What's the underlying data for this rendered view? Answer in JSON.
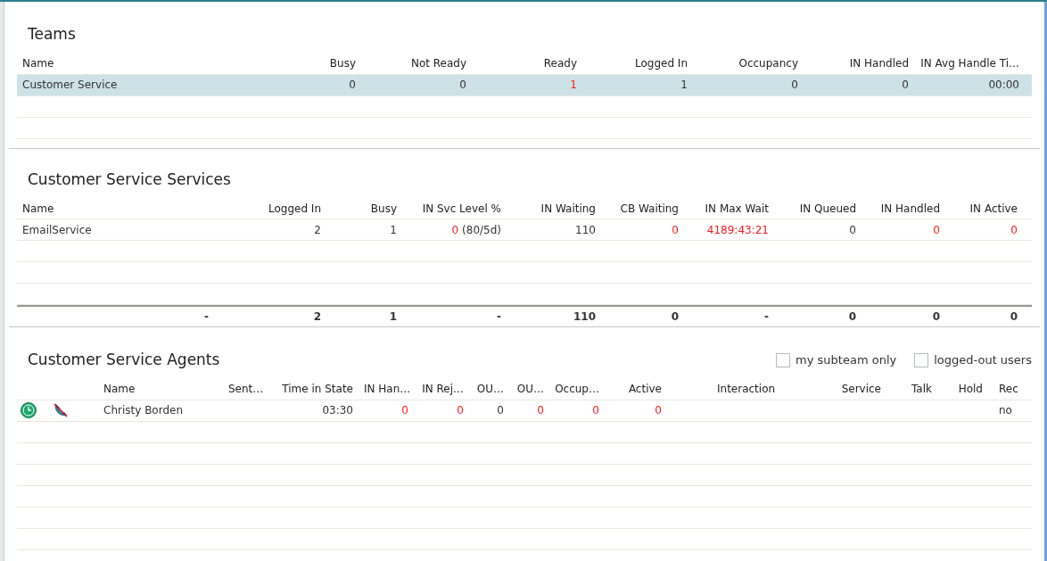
{
  "teams": {
    "title": "Teams",
    "columns": [
      "Name",
      "Busy",
      "Not Ready",
      "Ready",
      "Logged In",
      "Occupancy",
      "IN Handled",
      "IN Avg Handle Ti…"
    ],
    "rows": [
      {
        "selected": true,
        "cells": [
          "Customer Service",
          "0",
          "0",
          {
            "text": "1",
            "alert": true
          },
          "1",
          "0",
          "0",
          "00:00"
        ]
      }
    ]
  },
  "services": {
    "title": "Customer Service Services",
    "columns": [
      "Name",
      "Logged In",
      "Busy",
      "IN Svc Level %",
      "IN Waiting",
      "CB Waiting",
      "IN Max Wait",
      "IN Queued",
      "IN Handled",
      "IN Active"
    ],
    "rows": [
      {
        "selected": false,
        "cells": [
          "EmailService",
          "2",
          "1",
          {
            "text": "0",
            "alert": true,
            "note": "(80/5d)"
          },
          "110",
          {
            "text": "0",
            "alert": true
          },
          {
            "text": "4189:43:21",
            "alert": true
          },
          "0",
          {
            "text": "0",
            "alert": true
          },
          {
            "text": "0",
            "alert": true
          }
        ]
      }
    ],
    "totals": [
      "-",
      "2",
      "1",
      "-",
      "110",
      "0",
      "-",
      "0",
      "0",
      "0"
    ]
  },
  "agents": {
    "title": "Customer Service Agents",
    "filters": [
      {
        "label": "my subteam only",
        "checked": false
      },
      {
        "label": "logged-out users",
        "checked": false
      }
    ],
    "columns": [
      "",
      "",
      "Name",
      "Sent…",
      "Time in State",
      "IN Han…",
      "IN Rej…",
      "OU…",
      "OU…",
      "Occup…",
      "Active",
      "Interaction",
      "Service",
      "Talk",
      "Hold",
      "Rec"
    ],
    "rows": [
      {
        "cells": [
          "",
          "",
          "Christy Borden",
          "",
          "03:30",
          {
            "text": "0",
            "alert": true
          },
          {
            "text": "0",
            "alert": true
          },
          "0",
          {
            "text": "0",
            "alert": true
          },
          {
            "text": "0",
            "alert": true
          },
          {
            "text": "0",
            "alert": true
          },
          "",
          "",
          "",
          "",
          "no"
        ]
      }
    ]
  }
}
